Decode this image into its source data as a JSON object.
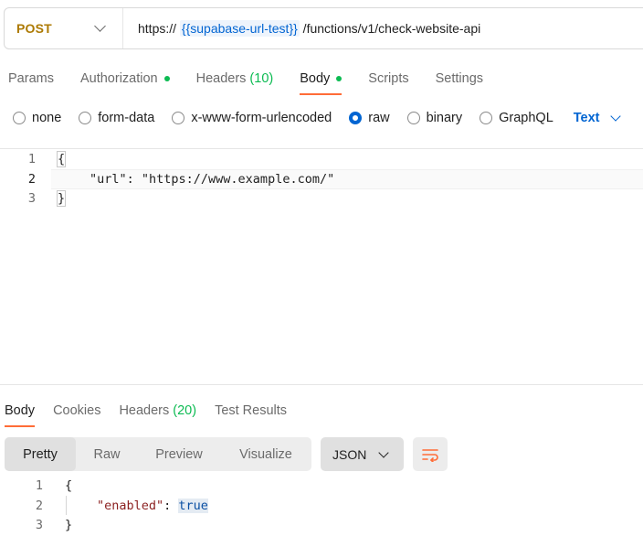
{
  "request": {
    "method": "POST",
    "url_prefix": "https://",
    "url_variable": "{{supabase-url-test}}",
    "url_suffix": " /functions/v1/check-website-api"
  },
  "request_tabs": [
    {
      "label": "Params",
      "active": false
    },
    {
      "label": "Authorization",
      "dot": true,
      "active": false
    },
    {
      "label": "Headers",
      "count": "(10)",
      "active": false
    },
    {
      "label": "Body",
      "dot": true,
      "active": true
    },
    {
      "label": "Scripts",
      "active": false
    },
    {
      "label": "Settings",
      "active": false
    }
  ],
  "body_types": [
    {
      "label": "none",
      "selected": false
    },
    {
      "label": "form-data",
      "selected": false
    },
    {
      "label": "x-www-form-urlencoded",
      "selected": false
    },
    {
      "label": "raw",
      "selected": true
    },
    {
      "label": "binary",
      "selected": false
    },
    {
      "label": "GraphQL",
      "selected": false
    }
  ],
  "raw_format": "Text",
  "request_body": {
    "line_numbers": [
      "1",
      "2",
      "3"
    ],
    "open_brace": "{",
    "line2": "\"url\": \"https://www.example.com/\"",
    "close_brace": "}"
  },
  "response_tabs": [
    {
      "label": "Body",
      "active": true
    },
    {
      "label": "Cookies",
      "active": false
    },
    {
      "label": "Headers",
      "count": "(20)",
      "active": false
    },
    {
      "label": "Test Results",
      "active": false
    }
  ],
  "view_modes": [
    {
      "label": "Pretty",
      "selected": true
    },
    {
      "label": "Raw",
      "selected": false
    },
    {
      "label": "Preview",
      "selected": false
    },
    {
      "label": "Visualize",
      "selected": false
    }
  ],
  "response_format": "JSON",
  "response_body": {
    "line_numbers": [
      "1",
      "2",
      "3"
    ],
    "open_brace": "{",
    "key": "\"enabled\"",
    "colon": ": ",
    "value": "true",
    "close_brace": "}"
  },
  "colors": {
    "accent": "#ff6c37",
    "method": "#ad7a03",
    "link": "#0265d2",
    "status_dot": "#0cbb52"
  }
}
